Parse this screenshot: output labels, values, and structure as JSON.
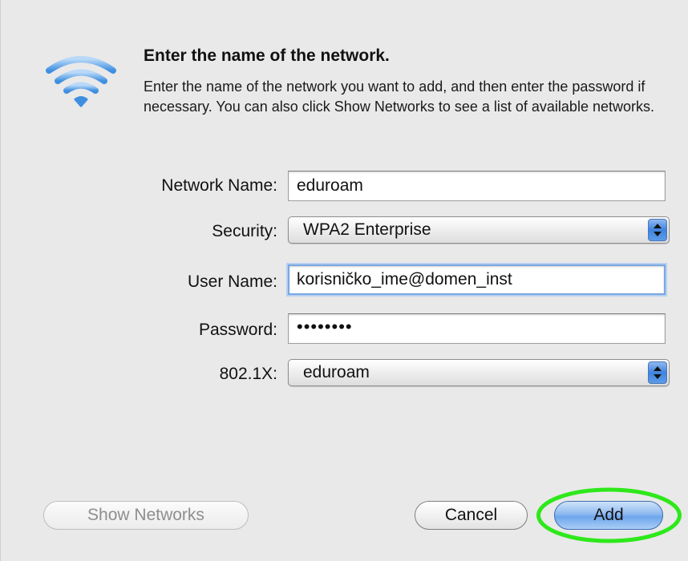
{
  "dialog": {
    "heading": "Enter the name of the network.",
    "description": "Enter the name of the network you want to add, and then enter the password if necessary. You can also click Show Networks to see a list of available networks.",
    "icon": "wifi-icon"
  },
  "form": {
    "network_name": {
      "label": "Network Name:",
      "value": "eduroam"
    },
    "security": {
      "label": "Security:",
      "value": "WPA2 Enterprise"
    },
    "user_name": {
      "label": "User Name:",
      "value": "korisničko_ime@domen_inst"
    },
    "password": {
      "label": "Password:",
      "value": "••••••••"
    },
    "dot1x": {
      "label": "802.1X:",
      "value": "eduroam"
    }
  },
  "buttons": {
    "show_networks": "Show Networks",
    "cancel": "Cancel",
    "add": "Add"
  },
  "colors": {
    "wifi_blue": "#4a90e2",
    "highlight_ring": "#2ee81a",
    "default_button": "#8ebaf0"
  }
}
